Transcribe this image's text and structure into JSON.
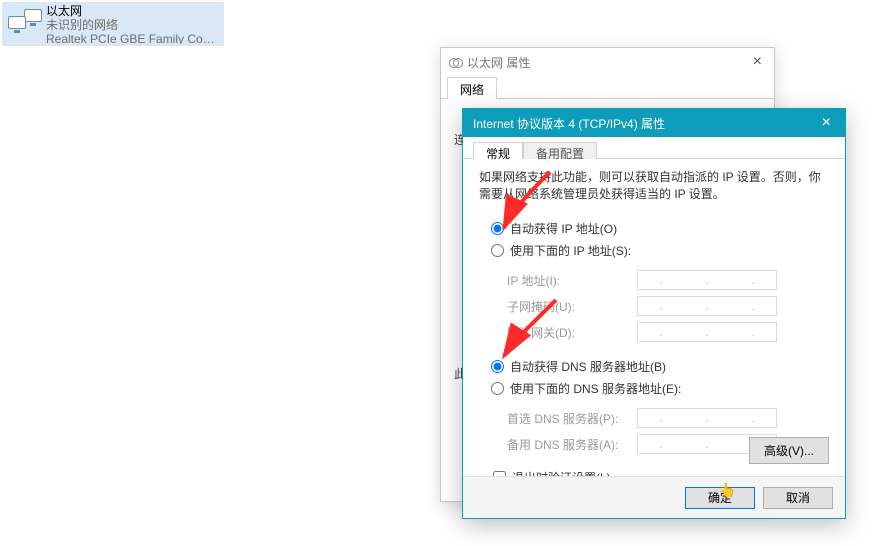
{
  "adapter": {
    "name": "以太网",
    "status": "未识别的网络",
    "device": "Realtek PCIe GBE Family Contr..."
  },
  "eth_window": {
    "title": "以太网 属性",
    "tab_network": "网络",
    "body_label_connect": "连",
    "body_label_this": "此"
  },
  "ipv4_window": {
    "title": "Internet 协议版本 4 (TCP/IPv4) 属性",
    "tab_general": "常规",
    "tab_alt": "备用配置",
    "description": "如果网络支持此功能，则可以获取自动指派的 IP 设置。否则，你需要从网络系统管理员处获得适当的 IP 设置。",
    "radio_auto_ip": "自动获得 IP 地址(O)",
    "radio_manual_ip": "使用下面的 IP 地址(S):",
    "label_ip": "IP 地址(I):",
    "label_mask": "子网掩码(U):",
    "label_gateway": "默认网关(D):",
    "radio_auto_dns": "自动获得 DNS 服务器地址(B)",
    "radio_manual_dns": "使用下面的 DNS 服务器地址(E):",
    "label_dns1": "首选 DNS 服务器(P):",
    "label_dns2": "备用 DNS 服务器(A):",
    "check_validate": "退出时验证设置(L)",
    "btn_advanced": "高级(V)...",
    "btn_ok": "确定",
    "btn_cancel": "取消"
  }
}
